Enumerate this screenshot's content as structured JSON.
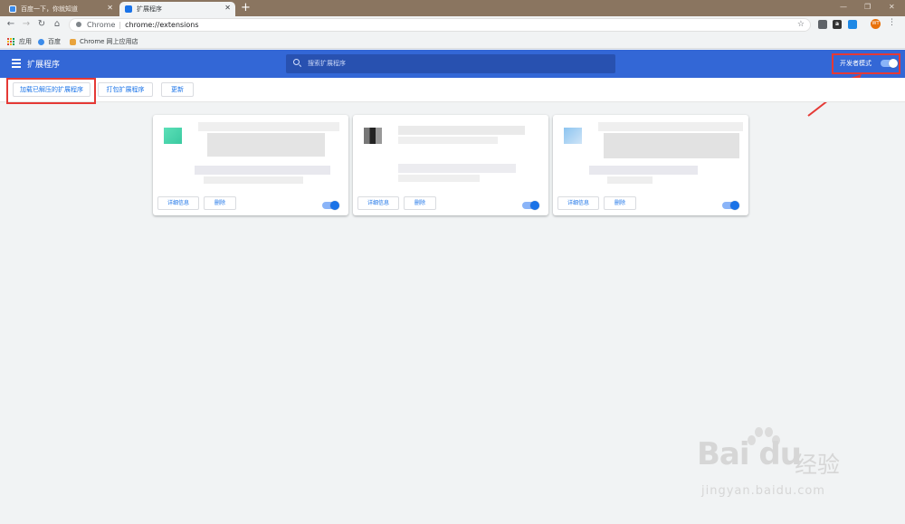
{
  "browser": {
    "tabs": [
      {
        "title": "百度一下，你就知道",
        "active": false
      },
      {
        "title": "扩展程序",
        "active": true
      }
    ],
    "new_tab": "+",
    "window_controls": [
      "—",
      "❐",
      "✕"
    ],
    "address": {
      "scheme_label": "Chrome",
      "separator": "|",
      "url": "chrome://extensions"
    },
    "avatar_initials": "WT",
    "bookmarks": [
      {
        "label": "应用",
        "icon": "apps-grid-icon"
      },
      {
        "label": "百度",
        "icon": "baidu-paw-icon"
      },
      {
        "label": "Chrome 网上应用店",
        "icon": "webstore-icon"
      }
    ]
  },
  "header": {
    "title": "扩展程序",
    "search_placeholder": "搜索扩展程序",
    "dev_mode_label": "开发者模式",
    "dev_mode_on": true
  },
  "actions": {
    "load_unpacked": "加载已解压的扩展程序",
    "pack": "打包扩展程序",
    "update": "更新"
  },
  "cards": [
    {
      "details": "详细信息",
      "remove": "删除",
      "enabled": true,
      "icon_color": "#5ce0b8"
    },
    {
      "details": "详细信息",
      "remove": "删除",
      "enabled": true,
      "icon_color": "#444444"
    },
    {
      "details": "详细信息",
      "remove": "删除",
      "enabled": true,
      "icon_color": "#8cc4f0"
    }
  ],
  "watermark": {
    "logo": "Bai du",
    "cn": "经验",
    "url": "jingyan.baidu.com"
  },
  "colors": {
    "header_bg": "#3367d6",
    "accent": "#1a73e8",
    "highlight": "#e53935"
  }
}
